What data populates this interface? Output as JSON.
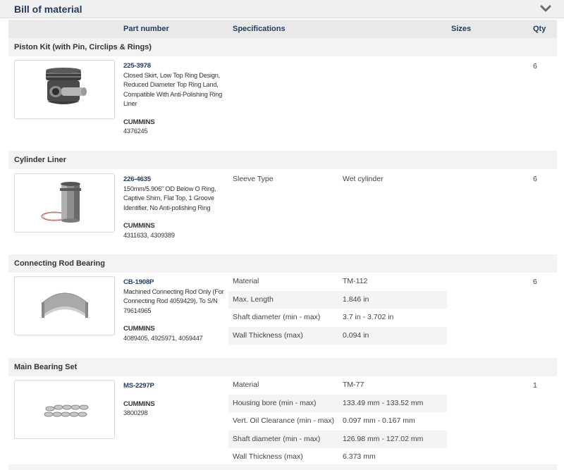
{
  "header": {
    "title": "Bill of material",
    "toggle_icon": "chevron-down-icon"
  },
  "columns": {
    "part_number": "Part number",
    "specifications": "Specifications",
    "sizes": "Sizes",
    "qty": "Qty"
  },
  "sections": [
    {
      "name": "Piston Kit (with Pin, Circlips & Rings)",
      "image_icon": "piston-kit-image",
      "part_number": "225-3978",
      "description": "Closed Skirt, Low Top Ring Design, Reduced Diameter Top Ring Land, Compatible With Anti-Polishing Ring Liner",
      "brand": "CUMMINS",
      "oem": "4376245",
      "specs": [],
      "qty": "6"
    },
    {
      "name": "Cylinder Liner",
      "image_icon": "cylinder-liner-image",
      "part_number": "226-4635",
      "description": "150mm/5.906\" OD Below O Ring, Captive Shim, Flat Top, 1 Groove Identifier, No Anti-polishing Ring",
      "brand": "CUMMINS",
      "oem": "4311633, 4309389",
      "specs": [
        {
          "label": "Sleeve Type",
          "value": "Wet cylinder"
        }
      ],
      "qty": "6"
    },
    {
      "name": "Connecting Rod Bearing",
      "image_icon": "connecting-rod-bearing-image",
      "part_number": "CB-1908P",
      "description": "Machined Connecting Rod Only (For Connecting Rod 4059429), To S/N 79614965",
      "brand": "CUMMINS",
      "oem": "4089405, 4925971, 4059447",
      "specs": [
        {
          "label": "Material",
          "value": "TM-112"
        },
        {
          "label": "Max. Length",
          "value": "1.846 in"
        },
        {
          "label": "Shaft diameter (min - max)",
          "value": "3.7 in - 3.702 in"
        },
        {
          "label": "Wall Thickness (max)",
          "value": "0.094 in"
        }
      ],
      "qty": "6"
    },
    {
      "name": "Main Bearing Set",
      "image_icon": "main-bearing-set-image",
      "part_number": "MS-2297P",
      "description": "",
      "brand": "CUMMINS",
      "oem": "3800298",
      "specs": [
        {
          "label": "Material",
          "value": "TM-77"
        },
        {
          "label": "Housing bore (min - max)",
          "value": "133.49 mm - 133.52 mm"
        },
        {
          "label": "Vert. Oil Clearance (min - max)",
          "value": "0.097 mm - 0.167 mm"
        },
        {
          "label": "Shaft diameter (min - max)",
          "value": "126.98 mm - 127.02 mm"
        },
        {
          "label": "Wall Thickness (max)",
          "value": "6.373 mm"
        }
      ],
      "qty": "1"
    }
  ]
}
